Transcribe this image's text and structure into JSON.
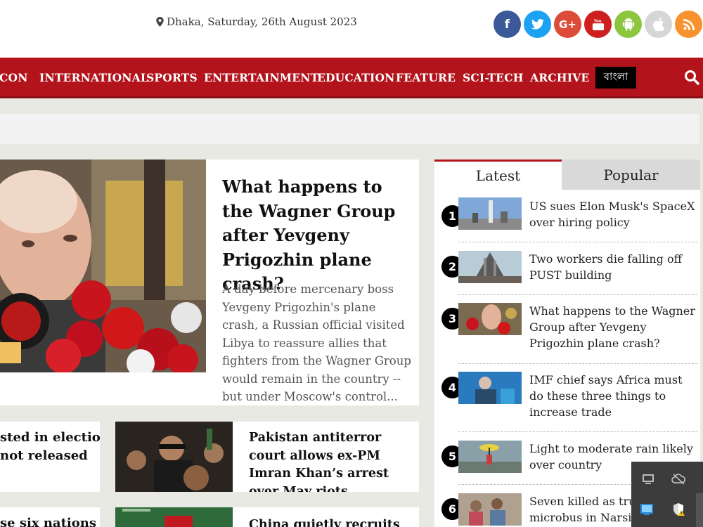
{
  "header": {
    "dateline": "Dhaka, Saturday, 26th August 2023",
    "social": [
      {
        "name": "facebook",
        "glyph": "f",
        "color": "#3b5998"
      },
      {
        "name": "twitter",
        "glyph": "t",
        "color": "#1da1f2"
      },
      {
        "name": "google-plus",
        "glyph": "G+",
        "color": "#dd4b39"
      },
      {
        "name": "youtube",
        "glyph": "▶",
        "color": "#cd201f"
      },
      {
        "name": "android",
        "glyph": "◆",
        "color": "#8cc63f"
      },
      {
        "name": "apple",
        "glyph": "●",
        "color": "#d6d6d6"
      },
      {
        "name": "rss",
        "glyph": ")",
        "color": "#f7922e"
      }
    ]
  },
  "nav": {
    "items": [
      "CON",
      "INTERNATIONAL",
      "SPORTS",
      "ENTERTAINMENT",
      "EDUCATION",
      "FEATURE",
      "SCI-TECH",
      "ARCHIVE"
    ],
    "bangla": "বাংলা"
  },
  "featured": {
    "title": "What happens to the Wagner Group after Yevgeny Prigozhin plane crash?",
    "summary": "A day before mercenary boss Yevgeny Prigozhin's plane crash, a Russian official visited Libya to reassure allies that fighters from the Wagner Group would remain in the country -- but under Moscow's control..."
  },
  "cards": [
    {
      "title": "sted in election\nnot released"
    },
    {
      "title": "Pakistan antiterror court allows ex-PM Imran Khan’s arrest over May riots"
    },
    {
      "title": "se six nations"
    },
    {
      "title": "China quietly recruits"
    }
  ],
  "sidebar": {
    "tabs": [
      "Latest",
      "Popular"
    ],
    "latest": [
      {
        "num": "1",
        "title": "US sues Elon Musk's SpaceX over hiring policy"
      },
      {
        "num": "2",
        "title": "Two workers die falling off PUST building"
      },
      {
        "num": "3",
        "title": "What happens to the Wagner Group after Yevgeny Prigozhin plane crash?"
      },
      {
        "num": "4",
        "title": "IMF chief says Africa must do these three things to increase trade"
      },
      {
        "num": "5",
        "title": "Light to moderate rain likely over country"
      },
      {
        "num": "6",
        "title": "Seven killed as truck-microbus in Narsingdi"
      }
    ]
  }
}
